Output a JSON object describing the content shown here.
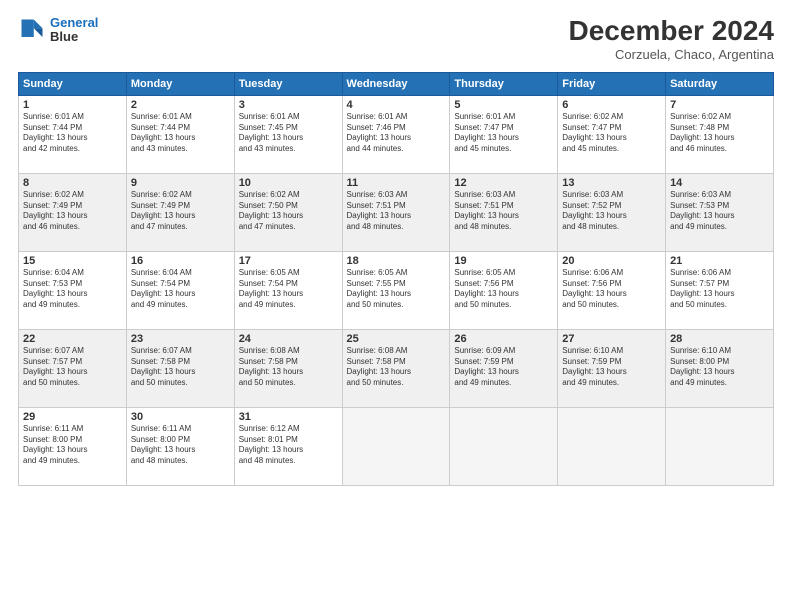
{
  "header": {
    "logo_line1": "General",
    "logo_line2": "Blue",
    "title": "December 2024",
    "subtitle": "Corzuela, Chaco, Argentina"
  },
  "calendar": {
    "days_of_week": [
      "Sunday",
      "Monday",
      "Tuesday",
      "Wednesday",
      "Thursday",
      "Friday",
      "Saturday"
    ],
    "weeks": [
      [
        {
          "day": "",
          "info": ""
        },
        {
          "day": "2",
          "info": "Sunrise: 6:01 AM\nSunset: 7:44 PM\nDaylight: 13 hours\nand 43 minutes."
        },
        {
          "day": "3",
          "info": "Sunrise: 6:01 AM\nSunset: 7:45 PM\nDaylight: 13 hours\nand 43 minutes."
        },
        {
          "day": "4",
          "info": "Sunrise: 6:01 AM\nSunset: 7:46 PM\nDaylight: 13 hours\nand 44 minutes."
        },
        {
          "day": "5",
          "info": "Sunrise: 6:01 AM\nSunset: 7:47 PM\nDaylight: 13 hours\nand 45 minutes."
        },
        {
          "day": "6",
          "info": "Sunrise: 6:02 AM\nSunset: 7:47 PM\nDaylight: 13 hours\nand 45 minutes."
        },
        {
          "day": "7",
          "info": "Sunrise: 6:02 AM\nSunset: 7:48 PM\nDaylight: 13 hours\nand 46 minutes."
        }
      ],
      [
        {
          "day": "1",
          "info": "Sunrise: 6:01 AM\nSunset: 7:44 PM\nDaylight: 13 hours\nand 42 minutes."
        },
        {
          "day": "",
          "info": ""
        },
        {
          "day": "",
          "info": ""
        },
        {
          "day": "",
          "info": ""
        },
        {
          "day": "",
          "info": ""
        },
        {
          "day": "",
          "info": ""
        },
        {
          "day": "",
          "info": ""
        }
      ],
      [
        {
          "day": "8",
          "info": "Sunrise: 6:02 AM\nSunset: 7:49 PM\nDaylight: 13 hours\nand 46 minutes."
        },
        {
          "day": "9",
          "info": "Sunrise: 6:02 AM\nSunset: 7:49 PM\nDaylight: 13 hours\nand 47 minutes."
        },
        {
          "day": "10",
          "info": "Sunrise: 6:02 AM\nSunset: 7:50 PM\nDaylight: 13 hours\nand 47 minutes."
        },
        {
          "day": "11",
          "info": "Sunrise: 6:03 AM\nSunset: 7:51 PM\nDaylight: 13 hours\nand 48 minutes."
        },
        {
          "day": "12",
          "info": "Sunrise: 6:03 AM\nSunset: 7:51 PM\nDaylight: 13 hours\nand 48 minutes."
        },
        {
          "day": "13",
          "info": "Sunrise: 6:03 AM\nSunset: 7:52 PM\nDaylight: 13 hours\nand 48 minutes."
        },
        {
          "day": "14",
          "info": "Sunrise: 6:03 AM\nSunset: 7:53 PM\nDaylight: 13 hours\nand 49 minutes."
        }
      ],
      [
        {
          "day": "15",
          "info": "Sunrise: 6:04 AM\nSunset: 7:53 PM\nDaylight: 13 hours\nand 49 minutes."
        },
        {
          "day": "16",
          "info": "Sunrise: 6:04 AM\nSunset: 7:54 PM\nDaylight: 13 hours\nand 49 minutes."
        },
        {
          "day": "17",
          "info": "Sunrise: 6:05 AM\nSunset: 7:54 PM\nDaylight: 13 hours\nand 49 minutes."
        },
        {
          "day": "18",
          "info": "Sunrise: 6:05 AM\nSunset: 7:55 PM\nDaylight: 13 hours\nand 50 minutes."
        },
        {
          "day": "19",
          "info": "Sunrise: 6:05 AM\nSunset: 7:56 PM\nDaylight: 13 hours\nand 50 minutes."
        },
        {
          "day": "20",
          "info": "Sunrise: 6:06 AM\nSunset: 7:56 PM\nDaylight: 13 hours\nand 50 minutes."
        },
        {
          "day": "21",
          "info": "Sunrise: 6:06 AM\nSunset: 7:57 PM\nDaylight: 13 hours\nand 50 minutes."
        }
      ],
      [
        {
          "day": "22",
          "info": "Sunrise: 6:07 AM\nSunset: 7:57 PM\nDaylight: 13 hours\nand 50 minutes."
        },
        {
          "day": "23",
          "info": "Sunrise: 6:07 AM\nSunset: 7:58 PM\nDaylight: 13 hours\nand 50 minutes."
        },
        {
          "day": "24",
          "info": "Sunrise: 6:08 AM\nSunset: 7:58 PM\nDaylight: 13 hours\nand 50 minutes."
        },
        {
          "day": "25",
          "info": "Sunrise: 6:08 AM\nSunset: 7:58 PM\nDaylight: 13 hours\nand 50 minutes."
        },
        {
          "day": "26",
          "info": "Sunrise: 6:09 AM\nSunset: 7:59 PM\nDaylight: 13 hours\nand 49 minutes."
        },
        {
          "day": "27",
          "info": "Sunrise: 6:10 AM\nSunset: 7:59 PM\nDaylight: 13 hours\nand 49 minutes."
        },
        {
          "day": "28",
          "info": "Sunrise: 6:10 AM\nSunset: 8:00 PM\nDaylight: 13 hours\nand 49 minutes."
        }
      ],
      [
        {
          "day": "29",
          "info": "Sunrise: 6:11 AM\nSunset: 8:00 PM\nDaylight: 13 hours\nand 49 minutes."
        },
        {
          "day": "30",
          "info": "Sunrise: 6:11 AM\nSunset: 8:00 PM\nDaylight: 13 hours\nand 48 minutes."
        },
        {
          "day": "31",
          "info": "Sunrise: 6:12 AM\nSunset: 8:01 PM\nDaylight: 13 hours\nand 48 minutes."
        },
        {
          "day": "",
          "info": ""
        },
        {
          "day": "",
          "info": ""
        },
        {
          "day": "",
          "info": ""
        },
        {
          "day": "",
          "info": ""
        }
      ]
    ]
  }
}
